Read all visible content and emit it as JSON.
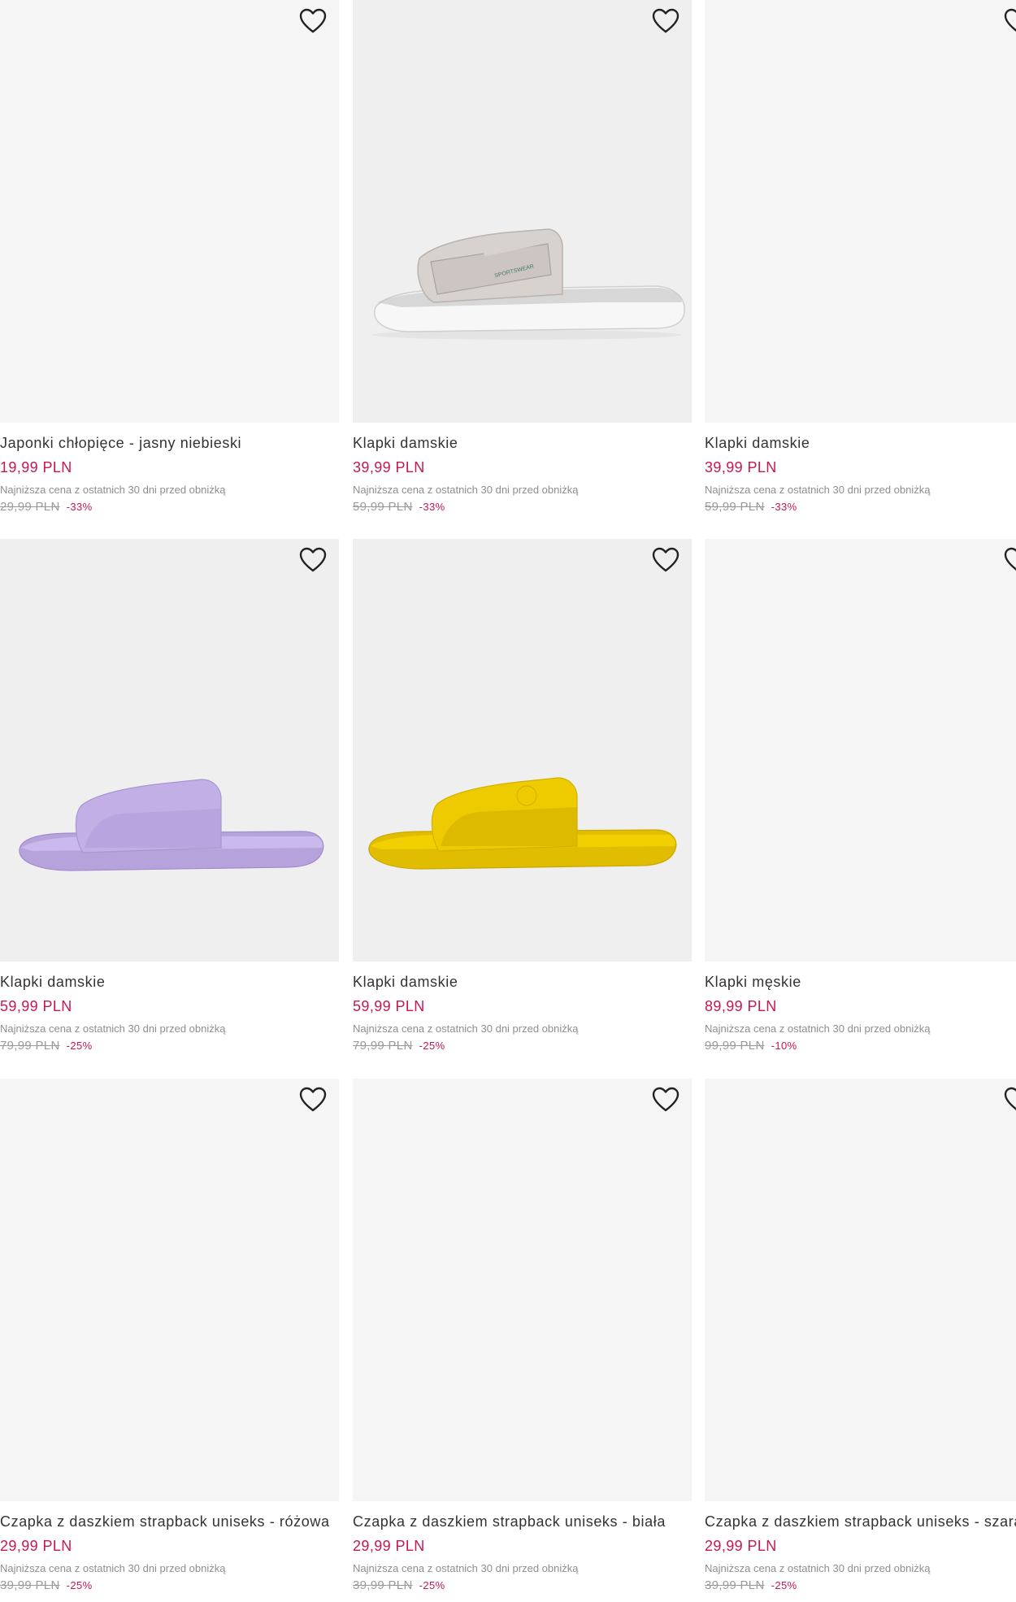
{
  "colors": {
    "price": "#c8174f",
    "discount": "#c8174f",
    "muted": "#9a9a9a",
    "image_bg": "#f4f5f4"
  },
  "icons": {
    "favorite": "heart-outline-icon"
  },
  "products": [
    {
      "name": "Japonki chłopięce - jasny niebieski",
      "price": "19,99 PLN",
      "lowest_note": "Najniższa cena z ostatnich 30 dni przed obniżką",
      "old_price": "29,99 PLN",
      "discount": "-33%"
    },
    {
      "name": "Klapki damskie",
      "price": "39,99 PLN",
      "lowest_note": "Najniższa cena z ostatnich 30 dni przed obniżką",
      "old_price": "59,99 PLN",
      "discount": "-33%",
      "image_text": "SPORTSWEAR"
    },
    {
      "name": "Klapki damskie",
      "price": "39,99 PLN",
      "lowest_note": "Najniższa cena z ostatnich 30 dni przed obniżką",
      "old_price": "59,99 PLN",
      "discount": "-33%"
    },
    {
      "name": "Klapki damskie",
      "price": "59,99 PLN",
      "lowest_note": "Najniższa cena z ostatnich 30 dni przed obniżką",
      "old_price": "79,99 PLN",
      "discount": "-25%"
    },
    {
      "name": "Klapki damskie",
      "price": "59,99 PLN",
      "lowest_note": "Najniższa cena z ostatnich 30 dni przed obniżką",
      "old_price": "79,99 PLN",
      "discount": "-25%"
    },
    {
      "name": "Klapki męskie",
      "price": "89,99 PLN",
      "lowest_note": "Najniższa cena z ostatnich 30 dni przed obniżką",
      "old_price": "99,99 PLN",
      "discount": "-10%"
    },
    {
      "name": "Czapka z daszkiem strapback uniseks - różowa",
      "price": "29,99 PLN",
      "lowest_note": "Najniższa cena z ostatnich 30 dni przed obniżką",
      "old_price": "39,99 PLN",
      "discount": "-25%"
    },
    {
      "name": "Czapka z daszkiem strapback uniseks - biała",
      "price": "29,99 PLN",
      "lowest_note": "Najniższa cena z ostatnich 30 dni przed obniżką",
      "old_price": "39,99 PLN",
      "discount": "-25%"
    },
    {
      "name": "Czapka z daszkiem strapback uniseks - szara",
      "price": "29,99 PLN",
      "lowest_note": "Najniższa cena z ostatnich 30 dni przed obniżką",
      "old_price": "39,99 PLN",
      "discount": "-25%"
    }
  ]
}
